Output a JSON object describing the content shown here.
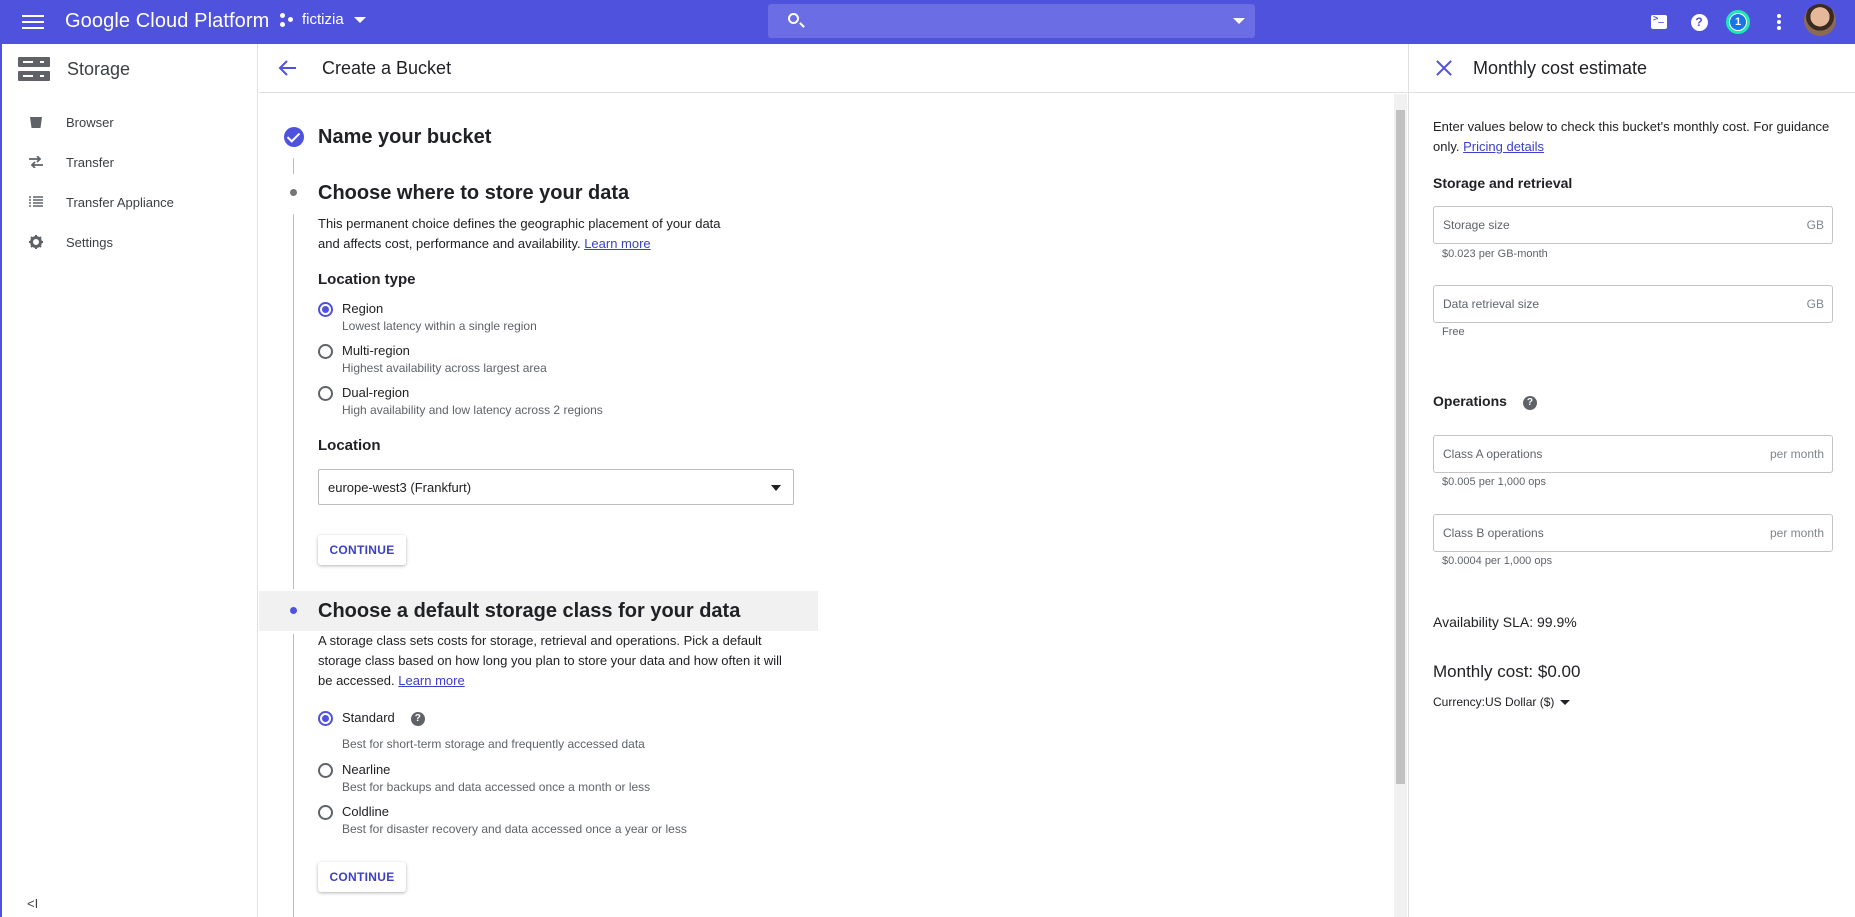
{
  "topbar": {
    "brand": "Google Cloud Platform",
    "project": "fictizia",
    "search_placeholder": "",
    "notifications_count": "1",
    "accent_color": "#4f52dc"
  },
  "leftnav": {
    "title": "Storage",
    "items": [
      {
        "label": "Browser",
        "icon": "bucket-icon"
      },
      {
        "label": "Transfer",
        "icon": "transfer-icon"
      },
      {
        "label": "Transfer Appliance",
        "icon": "appliance-list-icon"
      },
      {
        "label": "Settings",
        "icon": "gear-icon"
      }
    ],
    "collapse_label": "<I"
  },
  "header": {
    "title": "Create a Bucket"
  },
  "steps": {
    "name": {
      "title": "Name your bucket"
    },
    "location": {
      "title": "Choose where to store your data",
      "description": "This permanent choice defines the geographic placement of your data and affects cost, performance and availability.",
      "learn_more": "Learn more",
      "location_type_label": "Location type",
      "options": [
        {
          "label": "Region",
          "sub": "Lowest latency within a single region",
          "selected": true
        },
        {
          "label": "Multi-region",
          "sub": "Highest availability across largest area",
          "selected": false
        },
        {
          "label": "Dual-region",
          "sub": "High availability and low latency across 2 regions",
          "selected": false
        }
      ],
      "location_label": "Location",
      "location_value": "europe-west3 (Frankfurt)",
      "continue": "CONTINUE"
    },
    "storage_class": {
      "title": "Choose a default storage class for your data",
      "description": "A storage class sets costs for storage, retrieval and operations. Pick a default storage class based on how long you plan to store your data and how often it will be accessed.",
      "learn_more": "Learn more",
      "options": [
        {
          "label": "Standard",
          "sub": "Best for short-term storage and frequently accessed data",
          "selected": true
        },
        {
          "label": "Nearline",
          "sub": "Best for backups and data accessed once a month or less",
          "selected": false
        },
        {
          "label": "Coldline",
          "sub": "Best for disaster recovery and data accessed once a year or less",
          "selected": false
        }
      ],
      "continue": "CONTINUE"
    }
  },
  "cost_panel": {
    "title": "Monthly cost estimate",
    "description": "Enter values below to check this bucket's monthly cost. For guidance only.",
    "pricing_link": "Pricing details",
    "storage_heading": "Storage and retrieval",
    "storage_size": {
      "placeholder": "Storage size",
      "unit": "GB",
      "hint": "$0.023 per GB-month"
    },
    "retrieval_size": {
      "placeholder": "Data retrieval size",
      "unit": "GB",
      "hint": "Free"
    },
    "operations_heading": "Operations",
    "class_a": {
      "placeholder": "Class A operations",
      "unit": "per month",
      "hint": "$0.005 per 1,000 ops"
    },
    "class_b": {
      "placeholder": "Class B operations",
      "unit": "per month",
      "hint": "$0.0004 per 1,000 ops"
    },
    "sla": "Availability SLA: 99.9%",
    "monthly_cost": "Monthly cost: $0.00",
    "currency": "Currency:US Dollar ($)"
  }
}
